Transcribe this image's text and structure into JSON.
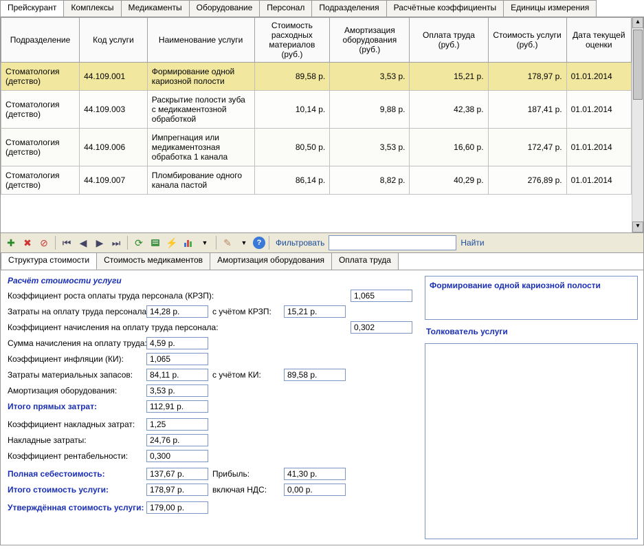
{
  "tabs": [
    "Прейскурант",
    "Комплексы",
    "Медикаменты",
    "Оборудование",
    "Персонал",
    "Подразделения",
    "Расчётные коэффициенты",
    "Единицы измерения"
  ],
  "grid": {
    "headers": [
      "Подразделение",
      "Код услуги",
      "Наименование услуги",
      "Стоимость расходных материалов (руб.)",
      "Амортизация оборудования (руб.)",
      "Оплата труда (руб.)",
      "Стоимость услуги (руб.)",
      "Дата текущей оценки"
    ],
    "rows": [
      {
        "dept": "Стоматология (детство)",
        "code": "44.109.001",
        "name": "Формирование одной кариозной полости",
        "mat": "89,58 р.",
        "amort": "3,53 р.",
        "labor": "15,21 р.",
        "cost": "178,97 р.",
        "date": "01.01.2014",
        "sel": true
      },
      {
        "dept": "Стоматология (детство)",
        "code": "44.109.003",
        "name": "Раскрытие полости зуба с медикаментозной обработкой",
        "mat": "10,14 р.",
        "amort": "9,88 р.",
        "labor": "42,38 р.",
        "cost": "187,41 р.",
        "date": "01.01.2014"
      },
      {
        "dept": "Стоматология (детство)",
        "code": "44.109.006",
        "name": "Импрегнация или медикаментозная обработка 1 канала",
        "mat": "80,50 р.",
        "amort": "3,53 р.",
        "labor": "16,60 р.",
        "cost": "172,47 р.",
        "date": "01.01.2014"
      },
      {
        "dept": "Стоматология (детство)",
        "code": "44.109.007",
        "name": "Пломбирование одного канала пастой",
        "mat": "86,14 р.",
        "amort": "8,82 р.",
        "labor": "40,29 р.",
        "cost": "276,89 р.",
        "date": "01.01.2014"
      }
    ]
  },
  "toolbar": {
    "filter_label": "Фильтровать",
    "find_label": "Найти"
  },
  "subtabs": [
    "Структура стоимости",
    "Стоимость медикаментов",
    "Амортизация оборудования",
    "Оплата труда"
  ],
  "detail": {
    "section_title": "Расчёт стоимости услуги",
    "krzp_label": "Коэффициент роста оплаты труда персонала (КРЗП):",
    "krzp": "1,065",
    "labor_cost_label": "Затраты на оплату труда персонала:",
    "labor_cost": "14,28 р.",
    "labor_krzp_label": "с учётом КРЗП:",
    "labor_krzp": "15,21 р.",
    "accrual_coef_label": "Коэффициент начисления на оплату труда персонала:",
    "accrual_coef": "0,302",
    "accrual_sum_label": "Сумма начисления на оплату труда:",
    "accrual_sum": "4,59 р.",
    "inflation_label": "Коэффициент инфляции (КИ):",
    "inflation": "1,065",
    "mat_cost_label": "Затраты материальных запасов:",
    "mat_cost": "84,11 р.",
    "mat_ki_label": "с учётом КИ:",
    "mat_ki": "89,58 р.",
    "amort_label": "Амортизация оборудования:",
    "amort": "3,53 р.",
    "direct_total_label": "Итого прямых затрат:",
    "direct_total": "112,91 р.",
    "overhead_coef_label": "Коэффициент накладных затрат:",
    "overhead_coef": "1,25",
    "overhead_label": "Накладные затраты:",
    "overhead": "24,76 р.",
    "profit_coef_label": "Коэффициент рентабельности:",
    "profit_coef": "0,300",
    "full_cost_label": "Полная себестоимость:",
    "full_cost": "137,67 р.",
    "profit_label": "Прибыль:",
    "profit": "41,30 р.",
    "total_cost_label": "Итого стоимость услуги:",
    "total_cost": "178,97 р.",
    "vat_label": "включая НДС:",
    "vat": "0,00 р.",
    "approved_label": "Утверждённая стоимость услуги:",
    "approved": "179,00 р."
  },
  "right": {
    "service_name": "Формирование одной кариозной полости",
    "interp_title": "Толкователь услуги"
  }
}
